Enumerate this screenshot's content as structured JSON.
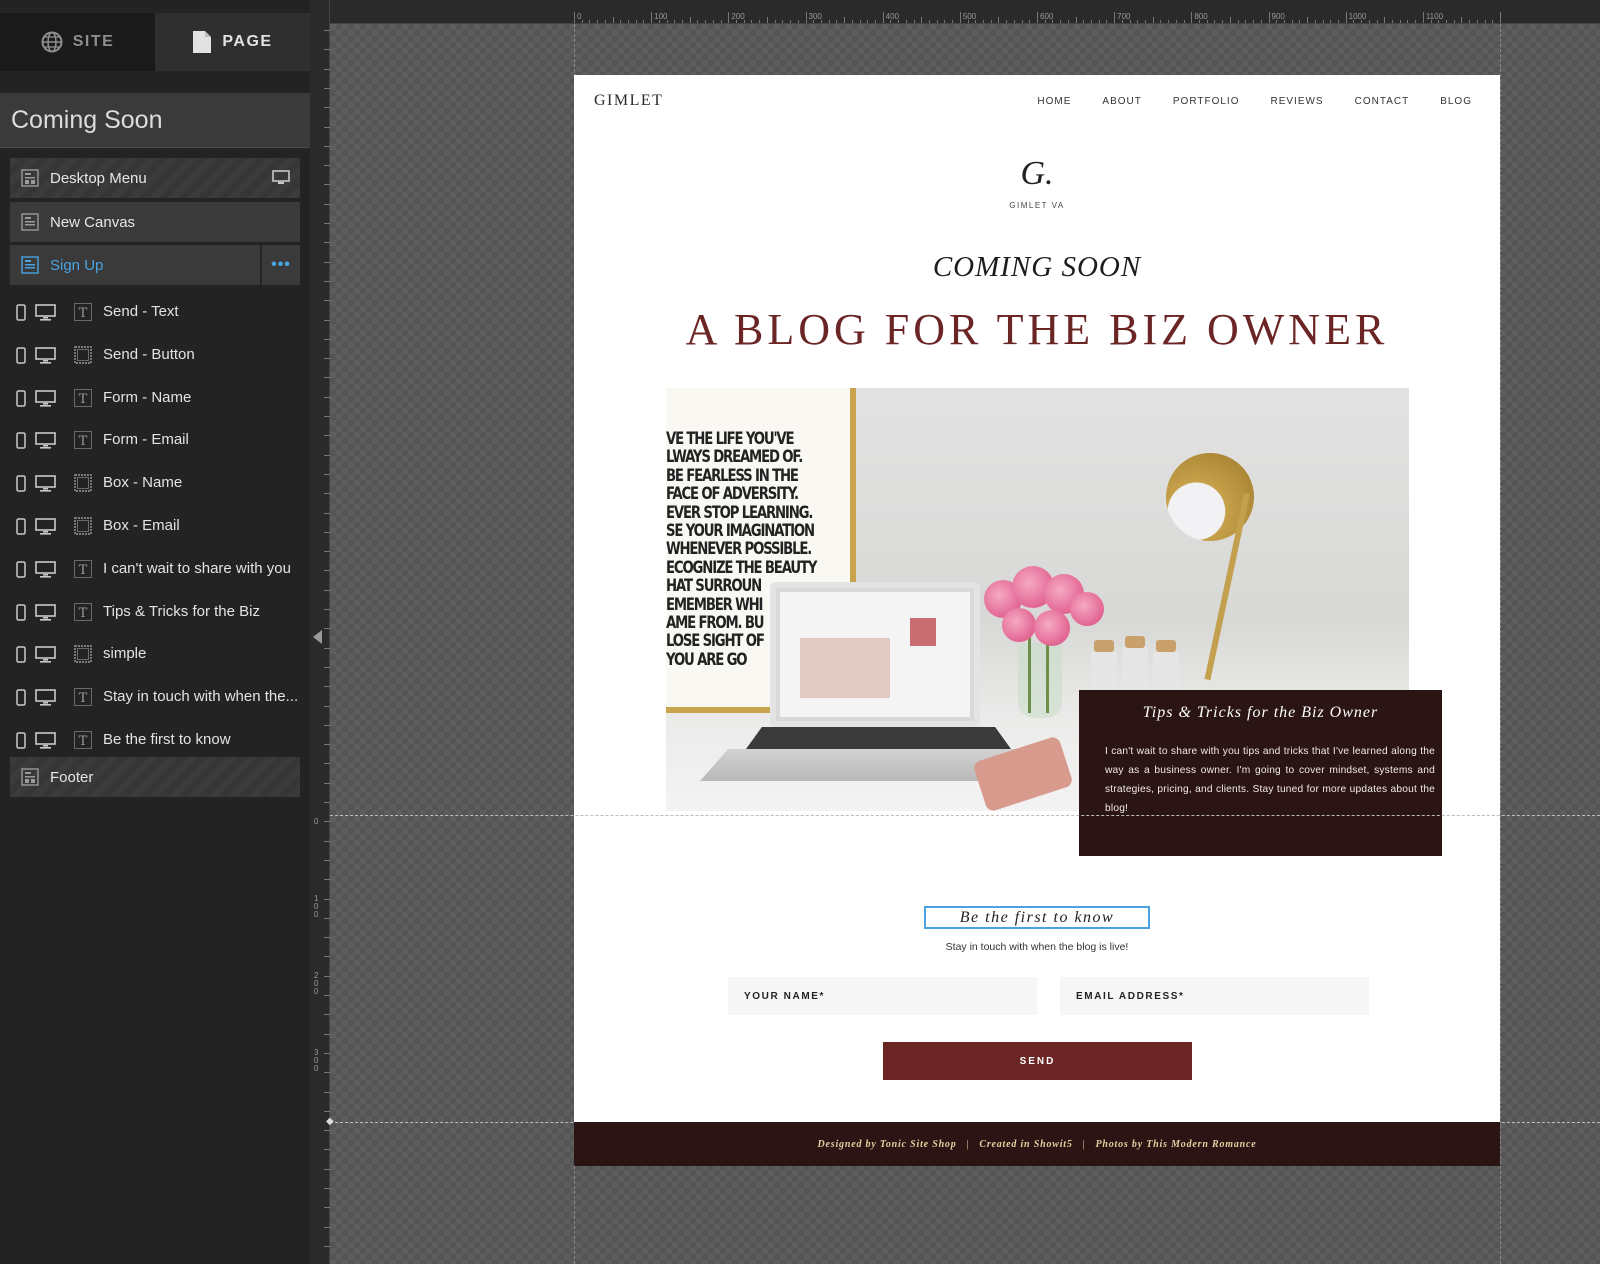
{
  "sidebar": {
    "tabs": {
      "site": "SITE",
      "page": "PAGE"
    },
    "page_title": "Coming Soon",
    "sections": {
      "desktop_menu": "Desktop Menu",
      "new_canvas": "New Canvas",
      "sign_up": "Sign Up",
      "footer": "Footer"
    },
    "elements": [
      {
        "label": "Send - Text",
        "type": "text"
      },
      {
        "label": "Send - Button",
        "type": "shape"
      },
      {
        "label": "Form - Name",
        "type": "text"
      },
      {
        "label": "Form - Email",
        "type": "text"
      },
      {
        "label": "Box - Name",
        "type": "shape"
      },
      {
        "label": "Box - Email",
        "type": "shape"
      },
      {
        "label": "I can't wait to share with you",
        "type": "text"
      },
      {
        "label": "Tips & Tricks for the Biz",
        "type": "text"
      },
      {
        "label": "simple",
        "type": "shape"
      },
      {
        "label": "Stay in touch with when the...",
        "type": "text"
      },
      {
        "label": "Be the first to know",
        "type": "text"
      }
    ],
    "more_label": "•••"
  },
  "ruler": {
    "top": [
      "0",
      "100",
      "200",
      "300",
      "400",
      "500",
      "600",
      "700",
      "800",
      "900",
      "1000",
      "1100"
    ],
    "left": [
      "0",
      "100",
      "200",
      "300"
    ]
  },
  "site": {
    "brand": "GIMLET",
    "nav": [
      "HOME",
      "ABOUT",
      "PORTFOLIO",
      "REVIEWS",
      "CONTACT",
      "BLOG"
    ],
    "monogram": "G.",
    "monogram_sub": "GIMLET VA",
    "coming_soon": "COMING SOON",
    "headline": "A BLOG FOR THE BIZ OWNER",
    "poster_text": "VE THE LIFE YOU'VE\nLWAYS DREAMED OF.\nBE FEARLESS IN THE\nFACE OF ADVERSITY.\nEVER STOP LEARNING.\nSE YOUR IMAGINATION\nWHENEVER POSSIBLE.\nECOGNIZE THE BEAUTY\nHAT SURROUN\nEMEMBER WHI\nAME FROM. BU\nLOSE SIGHT OF\n  YOU ARE GO",
    "tips": {
      "title": "Tips & Tricks for the Biz Owner",
      "body": "I can't wait to share with you tips and tricks that I've learned along the way as a business owner. I'm going to cover mindset, systems and strategies, pricing, and clients. Stay tuned for more updates about the blog!"
    },
    "signup": {
      "be_first": "Be the first to know",
      "stay": "Stay in touch with when the blog is live!",
      "name_field": "YOUR NAME*",
      "email_field": "EMAIL ADDRESS*",
      "send": "SEND"
    },
    "footer": {
      "designed": "Designed by Tonic Site Shop",
      "created": "Created in Showit5",
      "photos": "Photos by This Modern Romance",
      "sep": "|"
    }
  },
  "colors": {
    "accent": "#4aa3e0",
    "brand_maroon": "#6b2525",
    "dark_box": "#2b1414"
  }
}
